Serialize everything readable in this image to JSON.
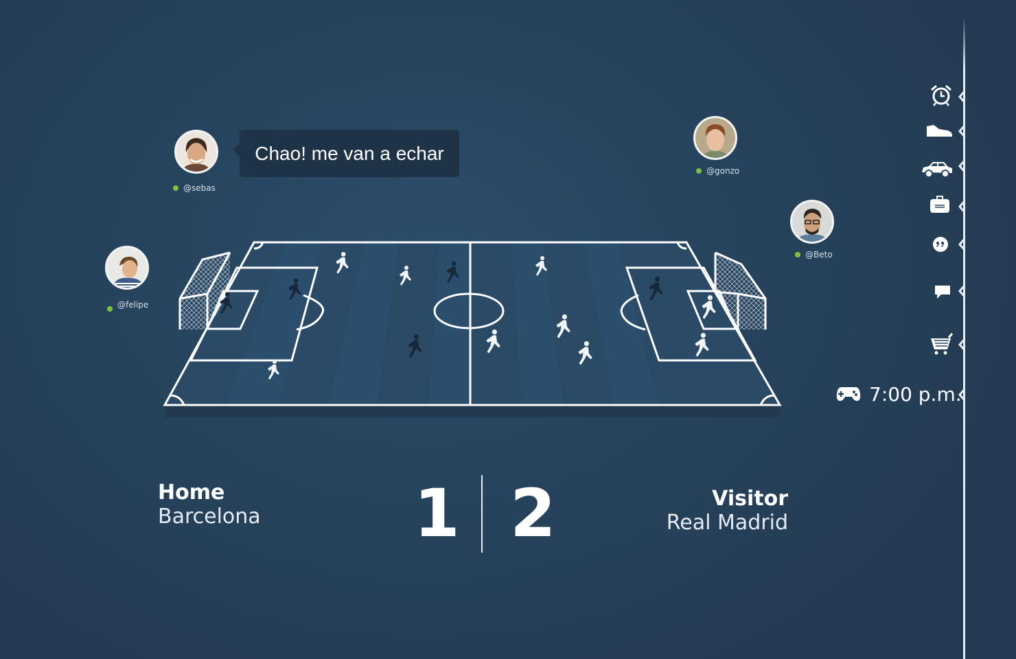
{
  "chat": {
    "message": "Chao! me van a echar"
  },
  "users": {
    "sebas": {
      "handle": "@sebas",
      "status_color": "#7cc23f"
    },
    "felipe": {
      "handle": "@felipe",
      "status_color": "#7cc23f"
    },
    "gonzo": {
      "handle": "@gonzo",
      "status_color": "#7cc23f"
    },
    "beto": {
      "handle": "@Beto",
      "status_color": "#7cc23f"
    }
  },
  "match": {
    "home": {
      "label": "Home",
      "team": "Barcelona",
      "score": "1"
    },
    "visitor": {
      "label": "Visitor",
      "team": "Real Madrid",
      "score": "2"
    }
  },
  "timeline": {
    "icons": [
      "alarm-clock-icon",
      "shoe-icon",
      "car-icon",
      "briefcase-icon",
      "quote-icon",
      "chat-icon",
      "cart-icon",
      "gamepad-icon"
    ],
    "event_time": "7:00 p.m."
  },
  "colors": {
    "background": "#27445e",
    "field_lines": "#ffffff",
    "online": "#7cc23f",
    "bubble": "#1e3346"
  }
}
